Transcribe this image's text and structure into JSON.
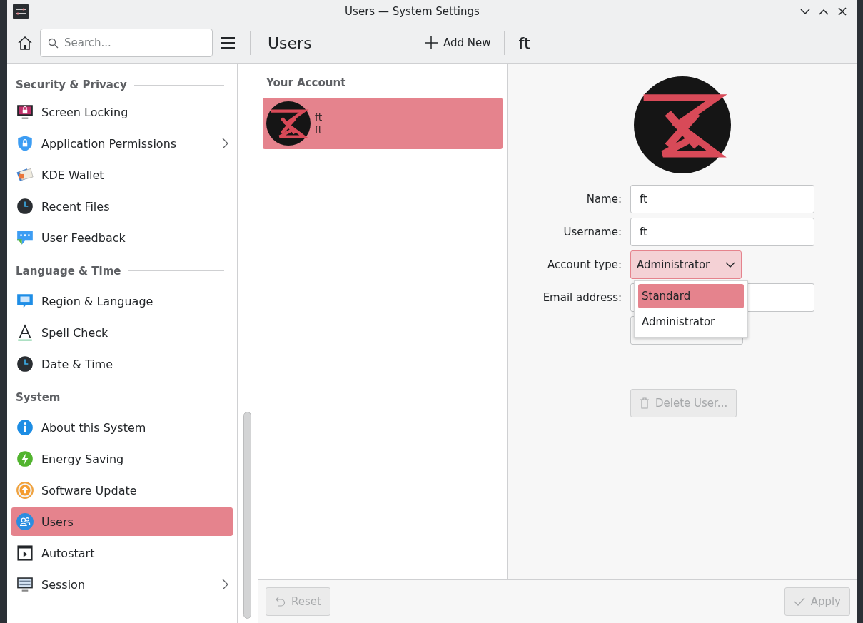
{
  "window": {
    "title": "Users — System Settings"
  },
  "toolbar": {
    "search_placeholder": "Search...",
    "page_title": "Users",
    "add_new": "Add New",
    "detail_title": "ft"
  },
  "sidebar": {
    "sections": [
      {
        "title": "Security & Privacy",
        "items": [
          {
            "label": "Screen Locking",
            "kind": "screen-lock",
            "arrow": false,
            "selected": false
          },
          {
            "label": "Application Permissions",
            "kind": "shield",
            "arrow": true,
            "selected": false
          },
          {
            "label": "KDE Wallet",
            "kind": "wallet",
            "arrow": false,
            "selected": false
          },
          {
            "label": "Recent Files",
            "kind": "clock",
            "arrow": false,
            "selected": false
          },
          {
            "label": "User Feedback",
            "kind": "feedback",
            "arrow": false,
            "selected": false
          }
        ]
      },
      {
        "title": "Language & Time",
        "items": [
          {
            "label": "Region & Language",
            "kind": "region",
            "arrow": false,
            "selected": false
          },
          {
            "label": "Spell Check",
            "kind": "spell",
            "arrow": false,
            "selected": false
          },
          {
            "label": "Date & Time",
            "kind": "clock",
            "arrow": false,
            "selected": false
          }
        ]
      },
      {
        "title": "System",
        "items": [
          {
            "label": "About this System",
            "kind": "info",
            "arrow": false,
            "selected": false
          },
          {
            "label": "Energy Saving",
            "kind": "energy",
            "arrow": false,
            "selected": false
          },
          {
            "label": "Software Update",
            "kind": "update",
            "arrow": false,
            "selected": false
          },
          {
            "label": "Users",
            "kind": "users",
            "arrow": false,
            "selected": true
          },
          {
            "label": "Autostart",
            "kind": "autostart",
            "arrow": false,
            "selected": false
          },
          {
            "label": "Session",
            "kind": "session",
            "arrow": true,
            "selected": false
          }
        ]
      }
    ]
  },
  "accounts": {
    "title": "Your Account",
    "users": [
      {
        "name": "ft",
        "username": "ft",
        "selected": true
      }
    ]
  },
  "form": {
    "name_label": "Name:",
    "name_value": "ft",
    "username_label": "Username:",
    "username_value": "ft",
    "account_type_label": "Account type:",
    "account_type_value": "Administrator",
    "account_type_options": [
      {
        "label": "Standard",
        "selected": true
      },
      {
        "label": "Administrator",
        "selected": false
      }
    ],
    "email_label": "Email address:",
    "delete_button": {
      "label": "Delete User...",
      "disabled": true
    }
  },
  "footer": {
    "reset": {
      "label": "Reset",
      "disabled": true
    },
    "apply": {
      "label": "Apply",
      "disabled": true
    }
  }
}
